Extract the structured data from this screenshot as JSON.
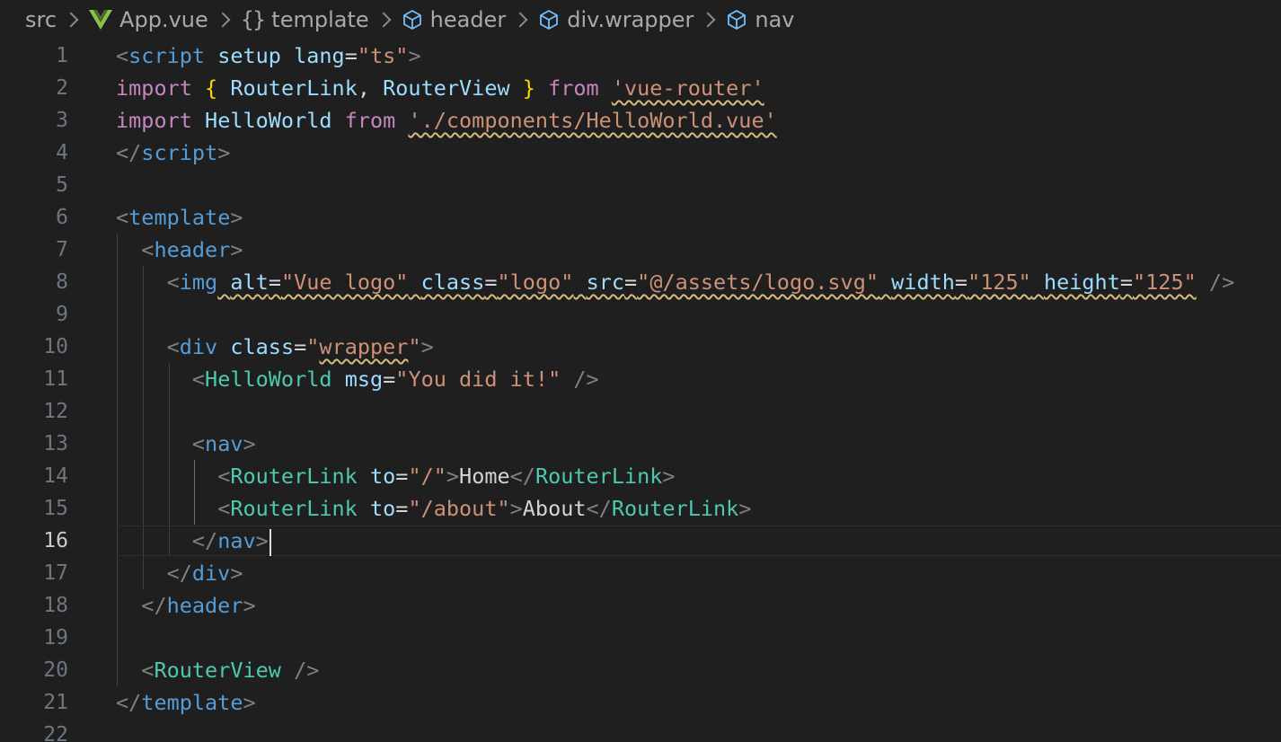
{
  "breadcrumb": {
    "items": [
      {
        "label": "src",
        "icon": "none"
      },
      {
        "label": "App.vue",
        "icon": "vue-icon"
      },
      {
        "label": "template",
        "icon": "braces-icon",
        "icon_text": "{}"
      },
      {
        "label": "header",
        "icon": "cube-icon"
      },
      {
        "label": "div.wrapper",
        "icon": "cube-icon"
      },
      {
        "label": "nav",
        "icon": "cube-icon"
      }
    ]
  },
  "editor": {
    "active_line": 16,
    "line_numbers": [
      "1",
      "2",
      "3",
      "4",
      "5",
      "6",
      "7",
      "8",
      "9",
      "10",
      "11",
      "12",
      "13",
      "14",
      "15",
      "16",
      "17",
      "18",
      "19",
      "20",
      "21",
      "22"
    ],
    "lines": [
      [
        {
          "t": "<",
          "c": "pun"
        },
        {
          "t": "script",
          "c": "tag"
        },
        {
          "t": " ",
          "c": "txt"
        },
        {
          "t": "setup",
          "c": "att"
        },
        {
          "t": " ",
          "c": "txt"
        },
        {
          "t": "lang",
          "c": "att"
        },
        {
          "t": "=",
          "c": "txt"
        },
        {
          "t": "\"ts\"",
          "c": "str"
        },
        {
          "t": ">",
          "c": "pun"
        }
      ],
      [
        {
          "t": "import",
          "c": "kw"
        },
        {
          "t": " ",
          "c": "txt"
        },
        {
          "t": "{",
          "c": "brc"
        },
        {
          "t": " ",
          "c": "txt"
        },
        {
          "t": "RouterLink",
          "c": "var"
        },
        {
          "t": ", ",
          "c": "txt"
        },
        {
          "t": "RouterView",
          "c": "var"
        },
        {
          "t": " ",
          "c": "txt"
        },
        {
          "t": "}",
          "c": "brc"
        },
        {
          "t": " ",
          "c": "txt"
        },
        {
          "t": "from",
          "c": "kw"
        },
        {
          "t": " ",
          "c": "txt"
        },
        {
          "t": "'vue-router'",
          "c": "str",
          "w": true
        }
      ],
      [
        {
          "t": "import",
          "c": "kw"
        },
        {
          "t": " ",
          "c": "txt"
        },
        {
          "t": "HelloWorld",
          "c": "var"
        },
        {
          "t": " ",
          "c": "txt"
        },
        {
          "t": "from",
          "c": "kw"
        },
        {
          "t": " ",
          "c": "txt"
        },
        {
          "t": "'./components/HelloWorld.vue'",
          "c": "str",
          "w": true
        }
      ],
      [
        {
          "t": "</",
          "c": "pun"
        },
        {
          "t": "script",
          "c": "tag"
        },
        {
          "t": ">",
          "c": "pun"
        }
      ],
      [],
      [
        {
          "t": "<",
          "c": "pun"
        },
        {
          "t": "template",
          "c": "tag"
        },
        {
          "t": ">",
          "c": "pun"
        }
      ],
      [
        {
          "t": "  ",
          "c": "txt"
        },
        {
          "t": "<",
          "c": "pun"
        },
        {
          "t": "header",
          "c": "tag"
        },
        {
          "t": ">",
          "c": "pun"
        }
      ],
      [
        {
          "t": "    ",
          "c": "txt"
        },
        {
          "t": "<",
          "c": "pun"
        },
        {
          "t": "img",
          "c": "tag"
        },
        {
          "t": " ",
          "c": "txt",
          "w": true
        },
        {
          "t": "alt",
          "c": "att",
          "w": true
        },
        {
          "t": "=",
          "c": "txt",
          "w": true
        },
        {
          "t": "\"Vue logo\"",
          "c": "str",
          "w": true
        },
        {
          "t": " ",
          "c": "txt",
          "w": true
        },
        {
          "t": "class",
          "c": "att",
          "w": true
        },
        {
          "t": "=",
          "c": "txt",
          "w": true
        },
        {
          "t": "\"logo\"",
          "c": "str",
          "w": true
        },
        {
          "t": " ",
          "c": "txt",
          "w": true
        },
        {
          "t": "src",
          "c": "att",
          "w": true
        },
        {
          "t": "=",
          "c": "txt",
          "w": true
        },
        {
          "t": "\"@/assets/logo.svg\"",
          "c": "str",
          "w": true
        },
        {
          "t": " ",
          "c": "txt",
          "w": true
        },
        {
          "t": "width",
          "c": "att",
          "w": true
        },
        {
          "t": "=",
          "c": "txt",
          "w": true
        },
        {
          "t": "\"125\"",
          "c": "str",
          "w": true
        },
        {
          "t": " ",
          "c": "txt",
          "w": true
        },
        {
          "t": "height",
          "c": "att",
          "w": true
        },
        {
          "t": "=",
          "c": "txt",
          "w": true
        },
        {
          "t": "\"125\"",
          "c": "str",
          "w": true
        },
        {
          "t": " ",
          "c": "txt"
        },
        {
          "t": "/>",
          "c": "pun"
        }
      ],
      [],
      [
        {
          "t": "    ",
          "c": "txt"
        },
        {
          "t": "<",
          "c": "pun"
        },
        {
          "t": "div",
          "c": "tag"
        },
        {
          "t": " ",
          "c": "txt"
        },
        {
          "t": "class",
          "c": "att"
        },
        {
          "t": "=",
          "c": "txt"
        },
        {
          "t": "\"",
          "c": "str"
        },
        {
          "t": "wrapper",
          "c": "str",
          "w": true
        },
        {
          "t": "\"",
          "c": "str"
        },
        {
          "t": ">",
          "c": "pun"
        }
      ],
      [
        {
          "t": "      ",
          "c": "txt"
        },
        {
          "t": "<",
          "c": "pun"
        },
        {
          "t": "HelloWorld",
          "c": "cmp"
        },
        {
          "t": " ",
          "c": "txt"
        },
        {
          "t": "msg",
          "c": "att"
        },
        {
          "t": "=",
          "c": "txt"
        },
        {
          "t": "\"You did it!\"",
          "c": "str"
        },
        {
          "t": " ",
          "c": "txt"
        },
        {
          "t": "/>",
          "c": "pun"
        }
      ],
      [],
      [
        {
          "t": "      ",
          "c": "txt"
        },
        {
          "t": "<",
          "c": "pun"
        },
        {
          "t": "nav",
          "c": "tag"
        },
        {
          "t": ">",
          "c": "pun"
        }
      ],
      [
        {
          "t": "        ",
          "c": "txt"
        },
        {
          "t": "<",
          "c": "pun"
        },
        {
          "t": "RouterLink",
          "c": "cmp"
        },
        {
          "t": " ",
          "c": "txt"
        },
        {
          "t": "to",
          "c": "att"
        },
        {
          "t": "=",
          "c": "txt"
        },
        {
          "t": "\"/\"",
          "c": "str"
        },
        {
          "t": ">",
          "c": "pun"
        },
        {
          "t": "Home",
          "c": "txt"
        },
        {
          "t": "</",
          "c": "pun"
        },
        {
          "t": "RouterLink",
          "c": "cmp"
        },
        {
          "t": ">",
          "c": "pun"
        }
      ],
      [
        {
          "t": "        ",
          "c": "txt"
        },
        {
          "t": "<",
          "c": "pun"
        },
        {
          "t": "RouterLink",
          "c": "cmp"
        },
        {
          "t": " ",
          "c": "txt"
        },
        {
          "t": "to",
          "c": "att"
        },
        {
          "t": "=",
          "c": "txt"
        },
        {
          "t": "\"/about\"",
          "c": "str"
        },
        {
          "t": ">",
          "c": "pun"
        },
        {
          "t": "About",
          "c": "txt"
        },
        {
          "t": "</",
          "c": "pun"
        },
        {
          "t": "RouterLink",
          "c": "cmp"
        },
        {
          "t": ">",
          "c": "pun"
        }
      ],
      [
        {
          "t": "      ",
          "c": "txt"
        },
        {
          "t": "</",
          "c": "pun"
        },
        {
          "t": "nav",
          "c": "tag"
        },
        {
          "t": ">",
          "c": "pun"
        }
      ],
      [
        {
          "t": "    ",
          "c": "txt"
        },
        {
          "t": "</",
          "c": "pun"
        },
        {
          "t": "div",
          "c": "tag"
        },
        {
          "t": ">",
          "c": "pun"
        }
      ],
      [
        {
          "t": "  ",
          "c": "txt"
        },
        {
          "t": "</",
          "c": "pun"
        },
        {
          "t": "header",
          "c": "tag"
        },
        {
          "t": ">",
          "c": "pun"
        }
      ],
      [],
      [
        {
          "t": "  ",
          "c": "txt"
        },
        {
          "t": "<",
          "c": "pun"
        },
        {
          "t": "RouterView",
          "c": "cmp"
        },
        {
          "t": " ",
          "c": "txt"
        },
        {
          "t": "/>",
          "c": "pun"
        }
      ],
      [
        {
          "t": "</",
          "c": "pun"
        },
        {
          "t": "template",
          "c": "tag"
        },
        {
          "t": ">",
          "c": "pun"
        }
      ],
      []
    ]
  }
}
